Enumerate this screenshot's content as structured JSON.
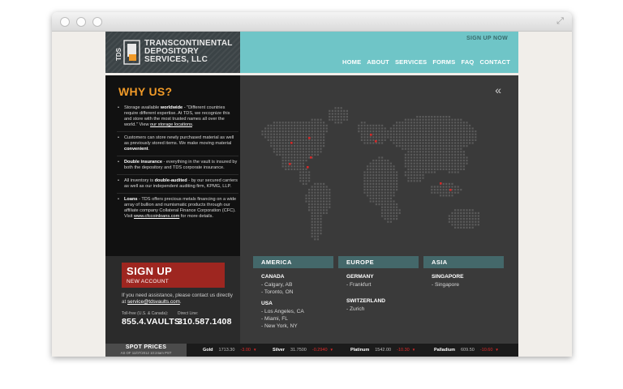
{
  "site": {
    "logo_abbrev": "TDS",
    "logo_lines": [
      "TRANSCONTINENTAL",
      "DEPOSITORY",
      "SERVICES, LLC"
    ],
    "signup_now": "SIGN UP NOW",
    "nav": [
      "HOME",
      "ABOUT",
      "SERVICES",
      "FORMS",
      "FAQ",
      "CONTACT"
    ]
  },
  "why": {
    "title": "WHY US?",
    "items": [
      {
        "pre": "Storage available ",
        "bold": "worldwide",
        "mid": " - \"Different countries require different expertise. At TDS, we recognize this and store with the most trusted names all over the world.\" View ",
        "link": "our storage locations",
        "post": "."
      },
      {
        "pre": "Customers can store newly purchased material as well as previously stored items. We make moving material ",
        "bold": "convenient",
        "mid": ".",
        "link": "",
        "post": ""
      },
      {
        "pre": "",
        "bold": "Double insurance",
        "mid": " - everything in the vault is insured by both the depository and TDS corporate insurance.",
        "link": "",
        "post": ""
      },
      {
        "pre": "All inventory is ",
        "bold": "double-audited",
        "mid": " - by our secured carriers as well as our independent auditing firm, KPMG, LLP.",
        "link": "",
        "post": ""
      },
      {
        "pre": "",
        "bold": "Loans",
        "mid": " - TDS offers precious metals financing on a wide array of bullion and numismatic products through our affiliate company Collateral Finance Corporation (CFC). Visit ",
        "link": "www.cfccoinloans.com",
        "post": " for more details."
      }
    ]
  },
  "signup": {
    "title": "SIGN UP",
    "subtitle": "NEW ACCOUNT",
    "assist_text": "If you need assistance, please contact us directly at ",
    "assist_email": "service@tdsvaults.com",
    "phone1_label": "Toll-free (U.S. & Canada):",
    "phone1": "855.4.VAULTS",
    "phone2_label": "Direct Line:",
    "phone2": "310.587.1408"
  },
  "map": {
    "collapse_icon": "double-chevron-left-icon",
    "dot_color": "#5a5a5a",
    "marker_color": "#d62828"
  },
  "regions": [
    {
      "name": "AMERICA",
      "countries": [
        {
          "name": "CANADA",
          "cities": [
            "- Calgary, AB",
            "- Toronto, ON"
          ]
        },
        {
          "name": "USA",
          "cities": [
            "- Los Angeles, CA",
            "- Miami, FL",
            "- New York, NY"
          ]
        }
      ]
    },
    {
      "name": "EUROPE",
      "countries": [
        {
          "name": "GERMANY",
          "cities": [
            "- Frankfurt"
          ]
        },
        {
          "name": "SWITZERLAND",
          "cities": [
            "- Zurich"
          ]
        }
      ]
    },
    {
      "name": "ASIA",
      "countries": [
        {
          "name": "SINGAPORE",
          "cities": [
            "- Singapore"
          ]
        }
      ]
    }
  ],
  "ticker": {
    "title": "SPOT PRICES",
    "asof": "AS OF 11/07/2012 10:24am PST",
    "metals": [
      {
        "name": "Gold",
        "price": "1713.30",
        "change": "-3.00"
      },
      {
        "name": "Silver",
        "price": "31.7500",
        "change": "-0.2940"
      },
      {
        "name": "Platinum",
        "price": "1542.00",
        "change": "-10.30"
      },
      {
        "name": "Palladium",
        "price": "609.50",
        "change": "-10.60"
      }
    ]
  },
  "colors": {
    "teal": "#6fc5c7",
    "orange": "#f09a28",
    "red": "#9e2620",
    "region_header": "#44686a"
  }
}
